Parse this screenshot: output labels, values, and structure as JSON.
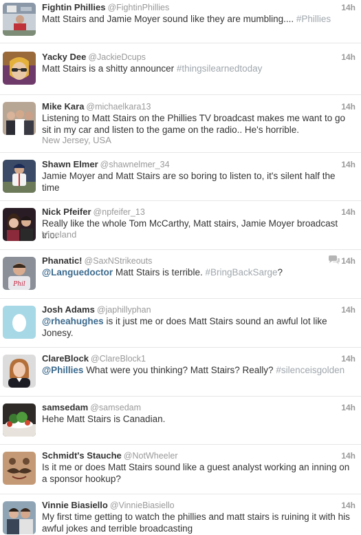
{
  "tweets": [
    {
      "name": "Fightin Phillies",
      "handle": "@FightinPhillies",
      "time": "14h",
      "pre": "Matt Stairs and Jamie Moyer sound like they are mumbling.... ",
      "mention": "",
      "body": "",
      "hashtag": "#Phillies",
      "location": "",
      "avatar_icon": "avatar-stadium-photo"
    },
    {
      "name": "Yacky Dee",
      "handle": "@JackieDcups",
      "time": "14h",
      "pre": "Matt Stairs is a shitty announcer ",
      "mention": "",
      "body": "",
      "hashtag": "#thingsilearnedtoday",
      "location": "",
      "avatar_icon": "avatar-sunglasses-photo"
    },
    {
      "name": "Mike Kara",
      "handle": "@michaelkara13",
      "time": "14h",
      "pre": "Listening to Matt Stairs on the Phillies TV broadcast makes me want to go sit in my car and listen to the game on the radio.. He's horrible.",
      "mention": "",
      "body": "",
      "hashtag": "",
      "location": "New Jersey, USA",
      "avatar_icon": "avatar-group-photo"
    },
    {
      "name": "Shawn Elmer",
      "handle": "@shawnelmer_34",
      "time": "14h",
      "pre": "Jamie Moyer and Matt Stairs are so boring to listen to, it's silent half the time",
      "mention": "",
      "body": "",
      "hashtag": "",
      "location": "",
      "avatar_icon": "avatar-baseball-player-photo"
    },
    {
      "name": "Nick Pfeifer",
      "handle": "@npfeifer_13",
      "time": "14h",
      "pre": "Really like the whole Tom McCarthy, Matt stairs, Jamie Moyer broadcast trio.",
      "mention": "",
      "body": "",
      "hashtag": "",
      "location": "Vineland",
      "avatar_icon": "avatar-couple-photo"
    },
    {
      "name": "Phanatic!",
      "handle": "@SaxNStrikeouts",
      "time": "14h",
      "pre": "",
      "mention": "@Languedoctor",
      "body": " Matt Stairs is terrible. ",
      "hashtag": "#BringBackSarge",
      "tail": "?",
      "location": "",
      "avatar_icon": "avatar-phillies-fan-photo",
      "conversation": true
    },
    {
      "name": "Josh Adams",
      "handle": "@japhillyphan",
      "time": "14h",
      "pre": "",
      "mention": "@rheahughes",
      "body": " is it just me or does Matt Stairs sound an awful lot like Jonesy.",
      "hashtag": "",
      "location": "",
      "avatar_icon": "avatar-default-egg"
    },
    {
      "name": "ClareBlock",
      "handle": "@ClareBlock1",
      "time": "14h",
      "pre": "",
      "mention": "@Phillies",
      "body": " What were you thinking? Matt Stairs? Really? ",
      "hashtag": "#silenceisgolden",
      "location": "",
      "avatar_icon": "avatar-woman-portrait"
    },
    {
      "name": "samsedam",
      "handle": "@samsedam",
      "time": "14h",
      "pre": "Hehe Matt Stairs is Canadian.",
      "mention": "",
      "body": "",
      "hashtag": "",
      "location": "",
      "avatar_icon": "avatar-food-photo"
    },
    {
      "name": "Schmidt's Stauche",
      "handle": "@NotWheeler",
      "time": "14h",
      "pre": "Is it me or does Matt Stairs sound like a guest analyst working an inning on a sponsor hookup?",
      "mention": "",
      "body": "",
      "hashtag": "",
      "location": "",
      "avatar_icon": "avatar-mustache-photo"
    },
    {
      "name": "Vinnie Biasiello",
      "handle": "@VinnieBiasiello",
      "time": "14h",
      "pre": "My first time getting to watch the phillies and matt stairs is ruining it with his awful jokes and terrible broadcasting",
      "mention": "",
      "body": "",
      "hashtag": "",
      "location": "",
      "avatar_icon": "avatar-two-men-photo"
    }
  ],
  "colors": {
    "mention": "#3b6a8d",
    "hashtag": "#a0a7ad",
    "meta": "#999999",
    "divider": "#e6e6e6"
  }
}
